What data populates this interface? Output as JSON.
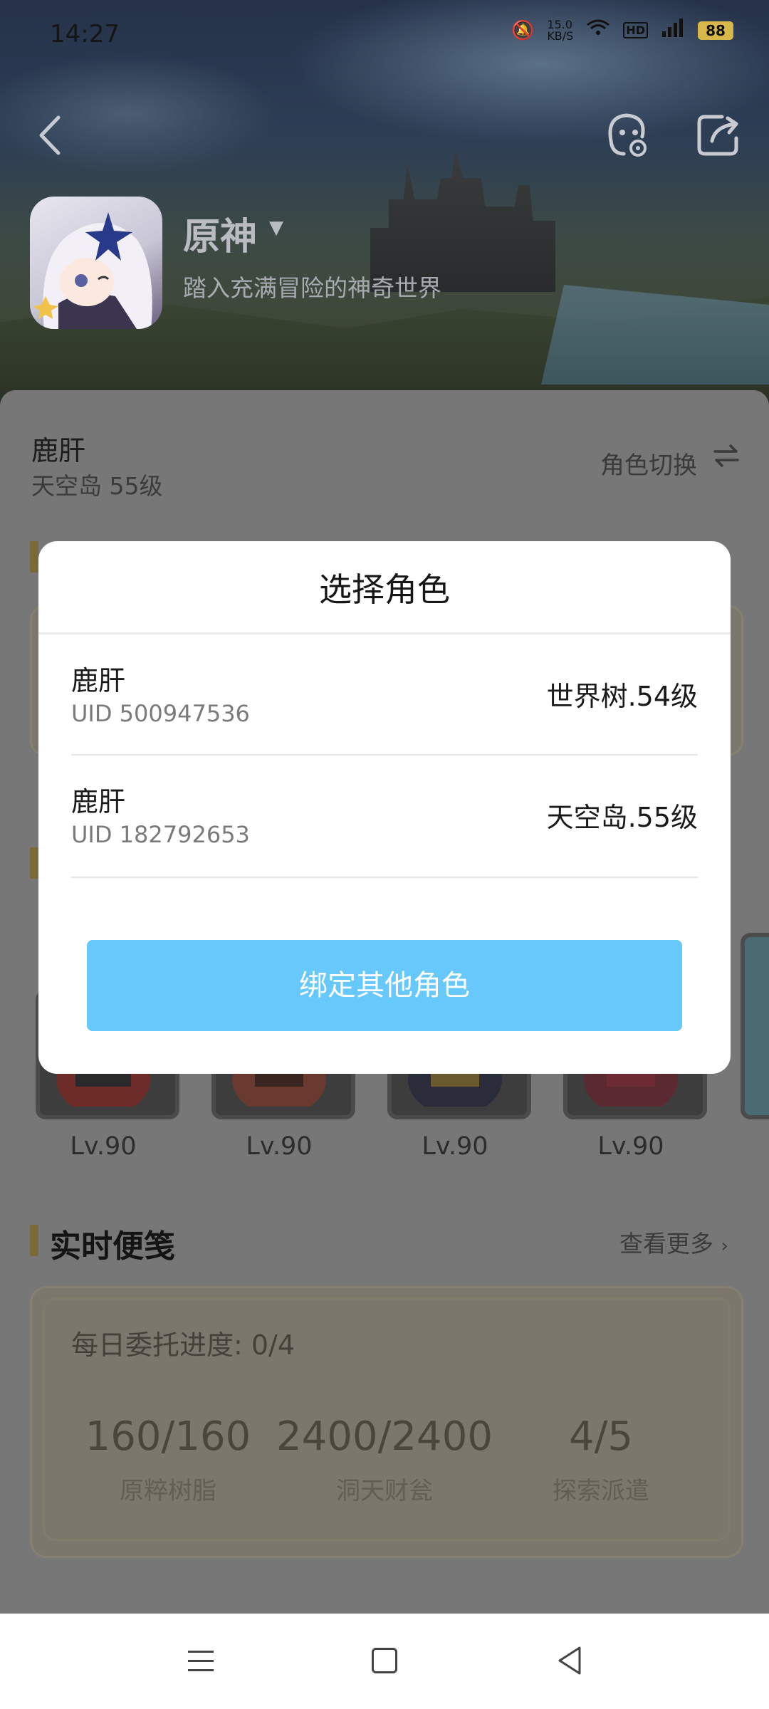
{
  "status_bar": {
    "time": "14:27",
    "net_speed_value": "15.0",
    "net_speed_unit": "KB/S",
    "battery": "88"
  },
  "game": {
    "title": "原神",
    "subtitle": "踏入充满冒险的神奇世界"
  },
  "role": {
    "name": "鹿肝",
    "server_level": "天空岛 55级",
    "switch_label": "角色切换"
  },
  "characters": [
    {
      "level": "Lv.90"
    },
    {
      "level": "Lv.90"
    },
    {
      "level": "Lv.90"
    },
    {
      "level": "Lv.90"
    }
  ],
  "notes": {
    "title": "实时便笺",
    "more_label": "查看更多",
    "daily_commission": "每日委托进度: 0/4",
    "stats": [
      {
        "value": "160/160",
        "label": "原粹树脂"
      },
      {
        "value": "2400/2400",
        "label": "洞天财瓮"
      },
      {
        "value": "4/5",
        "label": "探索派遣"
      }
    ]
  },
  "dialog": {
    "title": "选择角色",
    "items": [
      {
        "name": "鹿肝",
        "uid": "UID 500947536",
        "server": "世界树.54级"
      },
      {
        "name": "鹿肝",
        "uid": "UID 182792653",
        "server": "天空岛.55级"
      }
    ],
    "bind_button": "绑定其他角色"
  },
  "colors": {
    "accent": "#67c8fb",
    "overlay": "#777777",
    "gold": "#7a6a3a"
  },
  "icons": [
    "back-arrow-icon",
    "customer-service-icon",
    "share-icon",
    "swap-icon",
    "chevron-right-icon",
    "menu-icon",
    "home-icon",
    "back-triangle-icon"
  ]
}
